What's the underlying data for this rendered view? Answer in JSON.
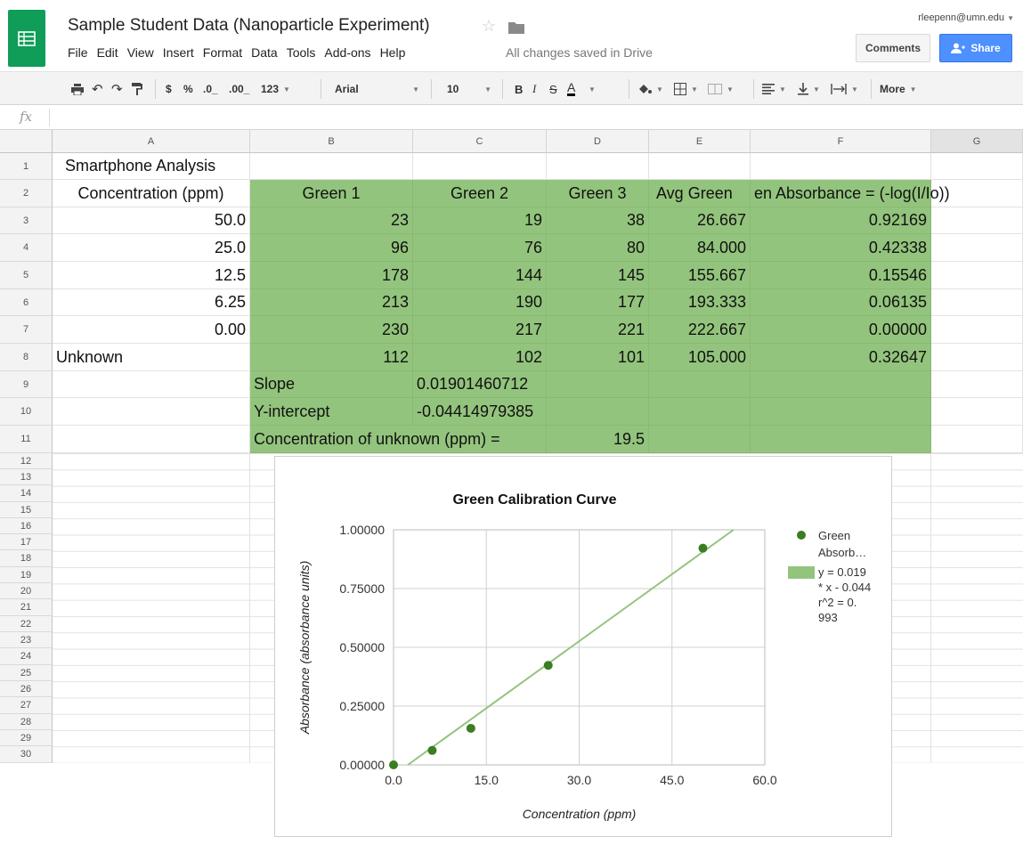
{
  "app": {
    "title": "Sample Student Data (Nanoparticle Experiment)",
    "user_email": "rleepenn@umn.edu",
    "save_status": "All changes saved in Drive",
    "menu": [
      "File",
      "Edit",
      "View",
      "Insert",
      "Format",
      "Data",
      "Tools",
      "Add-ons",
      "Help"
    ],
    "comments_label": "Comments",
    "share_label": "Share",
    "accent_color": "#0f9d58",
    "share_color": "#4d90fe"
  },
  "toolbar": {
    "currency": "$",
    "percent": "%",
    "decrease_decimals": ".0_",
    "increase_decimals": ".00_",
    "more_formats": "123",
    "font_family": "Arial",
    "font_size": "10",
    "bold": "B",
    "italic": "I",
    "strike": "S",
    "text_color": "A",
    "more": "More"
  },
  "formula_bar": {
    "icon": "fx"
  },
  "columns": [
    "A",
    "B",
    "C",
    "D",
    "E",
    "F",
    "G"
  ],
  "rows": [
    "1",
    "2",
    "3",
    "4",
    "5",
    "6",
    "7",
    "8",
    "9",
    "10",
    "11",
    "12",
    "13",
    "14",
    "15",
    "16",
    "17",
    "18",
    "19",
    "20",
    "21",
    "22",
    "23",
    "24",
    "25",
    "26",
    "27",
    "28",
    "29",
    "30"
  ],
  "sheet": {
    "title_cell": "Smartphone Analysis",
    "headers": [
      "Concentration (ppm)",
      "Green 1",
      "Green 2",
      "Green 3",
      "Avg Green",
      "en Absorbance = (-log(I/Io))"
    ],
    "data_rows": [
      [
        "50.0",
        "23",
        "19",
        "38",
        "26.667",
        "0.92169"
      ],
      [
        "25.0",
        "96",
        "76",
        "80",
        "84.000",
        "0.42338"
      ],
      [
        "12.5",
        "178",
        "144",
        "145",
        "155.667",
        "0.15546"
      ],
      [
        "6.25",
        "213",
        "190",
        "177",
        "193.333",
        "0.06135"
      ],
      [
        "0.00",
        "230",
        "217",
        "221",
        "222.667",
        "0.00000"
      ],
      [
        "Unknown",
        "112",
        "102",
        "101",
        "105.000",
        "0.32647"
      ]
    ],
    "slope_label": "Slope",
    "slope_value": "0.01901460712",
    "intercept_label": "Y-intercept",
    "intercept_value": "-0.04414979385",
    "unknown_label": "Concentration of unknown (ppm) =",
    "unknown_value": "19.5",
    "fill_color": "#93c47d"
  },
  "chart_data": {
    "type": "scatter",
    "title": "Green Calibration Curve",
    "xlabel": "Concentration (ppm)",
    "ylabel": "Absorbance (absorbance units)",
    "xlim": [
      0,
      60
    ],
    "ylim": [
      0,
      1
    ],
    "x_ticks": [
      "0.0",
      "15.0",
      "30.0",
      "45.0",
      "60.0"
    ],
    "y_ticks": [
      "0.00000",
      "0.25000",
      "0.50000",
      "0.75000",
      "1.00000"
    ],
    "grid": true,
    "legend_position": "right",
    "series": [
      {
        "name": "Green Absorb…",
        "x": [
          50.0,
          25.0,
          12.5,
          6.25,
          0.0
        ],
        "y": [
          0.92169,
          0.42338,
          0.15546,
          0.06135,
          0.0
        ],
        "color": "#3b7d23"
      }
    ],
    "trendline": {
      "slope": 0.019,
      "intercept": -0.044,
      "legend_lines": [
        "y = 0.019",
        "* x - 0.044",
        "r^2 = 0.",
        "993"
      ],
      "color": "#93c47d"
    }
  }
}
